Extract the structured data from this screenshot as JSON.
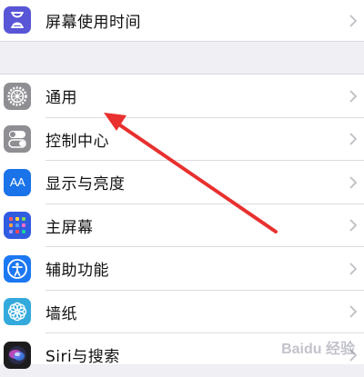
{
  "top_group": {
    "items": [
      {
        "label": "屏幕使用时间",
        "icon": "hourglass-icon",
        "color": "#5856d6"
      }
    ]
  },
  "main_group": {
    "items": [
      {
        "label": "通用",
        "icon": "gear-icon",
        "color": "#8e8e93"
      },
      {
        "label": "控制中心",
        "icon": "toggles-icon",
        "color": "#8e8e93"
      },
      {
        "label": "显示与亮度",
        "icon": "text-size-icon",
        "color": "#1a73e8"
      },
      {
        "label": "主屏幕",
        "icon": "app-grid-icon",
        "color": "#2f5ce0"
      },
      {
        "label": "辅助功能",
        "icon": "accessibility-icon",
        "color": "#1b78f2"
      },
      {
        "label": "墙纸",
        "icon": "flower-icon",
        "color": "#34aadc"
      },
      {
        "label": "Siri与搜索",
        "icon": "siri-icon",
        "color": "#1c1c1e"
      }
    ]
  },
  "annotation": {
    "color": "#e8302f"
  },
  "icon_glyphs": {
    "display_text": "AA"
  },
  "watermark": {
    "text": "Baidu 经验"
  }
}
